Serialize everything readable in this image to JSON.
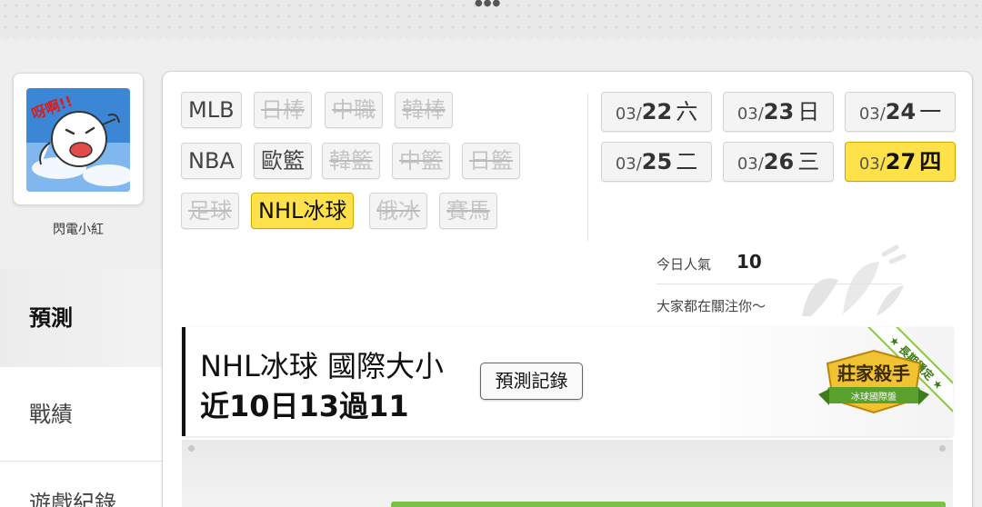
{
  "user": {
    "name": "閃電小紅"
  },
  "sidebar": {
    "tabs": [
      {
        "label": "預測"
      },
      {
        "label": "戰績"
      },
      {
        "label": "遊戲紀錄"
      }
    ]
  },
  "sports": [
    {
      "label": "MLB",
      "state": "normal"
    },
    {
      "label": "日棒",
      "state": "disabled"
    },
    {
      "label": "中職",
      "state": "disabled"
    },
    {
      "label": "韓棒",
      "state": "disabled"
    },
    {
      "label": "NBA",
      "state": "normal"
    },
    {
      "label": "歐籃",
      "state": "normal"
    },
    {
      "label": "韓籃",
      "state": "disabled"
    },
    {
      "label": "中籃",
      "state": "disabled"
    },
    {
      "label": "日籃",
      "state": "disabled"
    },
    {
      "label": "足球",
      "state": "disabled"
    },
    {
      "label": "NHL冰球",
      "state": "selected"
    },
    {
      "label": "俄冰",
      "state": "disabled"
    },
    {
      "label": "賽馬",
      "state": "disabled"
    }
  ],
  "dates": [
    {
      "month": "03/",
      "day": "22",
      "weekday": "六"
    },
    {
      "month": "03/",
      "day": "23",
      "weekday": "日"
    },
    {
      "month": "03/",
      "day": "24",
      "weekday": "一"
    },
    {
      "month": "03/",
      "day": "25",
      "weekday": "二"
    },
    {
      "month": "03/",
      "day": "26",
      "weekday": "三"
    },
    {
      "month": "03/",
      "day": "27",
      "weekday": "四",
      "selected": true
    }
  ],
  "popularity": {
    "label": "今日人氣",
    "value": "10",
    "message": "大家都在關注你～"
  },
  "record": {
    "title": "NHL冰球 國際大小",
    "summary": "近10日13過11",
    "button": "預測記錄",
    "badge": {
      "ribbon": "長期穩定",
      "title": "莊家殺手",
      "subtitle": "冰球國際盤"
    }
  },
  "colors": {
    "accent": "#ffe14a",
    "green": "#7cc143"
  }
}
